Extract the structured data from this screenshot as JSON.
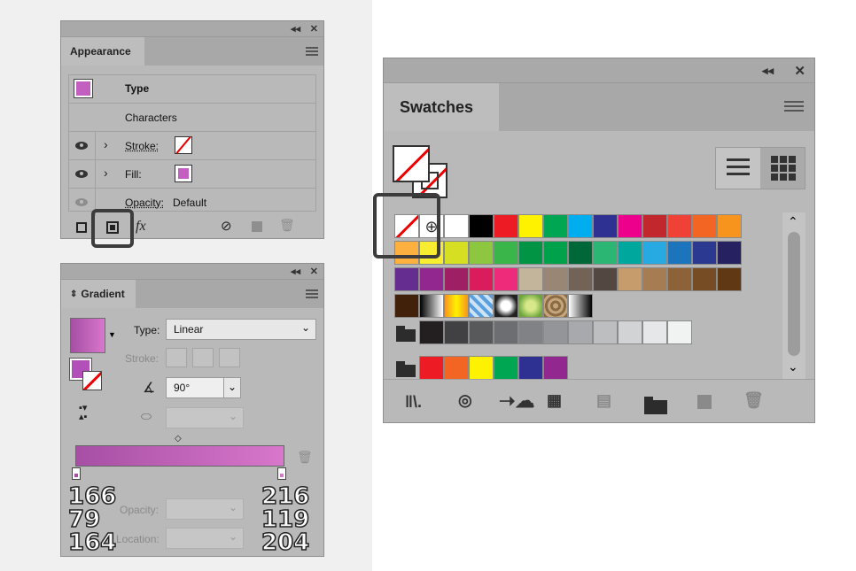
{
  "appearance": {
    "tab": "Appearance",
    "rows": {
      "type_label": "Type",
      "characters_label": "Characters",
      "stroke_label": "Stroke:",
      "fill_label": "Fill:",
      "opacity_label": "Opacity:",
      "opacity_value": "Default"
    },
    "footer": {
      "fx_label": "fx"
    }
  },
  "gradient": {
    "tab": "Gradient",
    "type_label": "Type:",
    "type_value": "Linear",
    "stroke_label": "Stroke:",
    "angle_value": "90°",
    "opacity_label": "Opacity:",
    "location_label": "Location:",
    "left_stop_rgb": [
      "166",
      "79",
      "164"
    ],
    "right_stop_rgb": [
      "216",
      "119",
      "204"
    ],
    "colors": {
      "start": "#a64fa4",
      "end": "#d877cc"
    }
  },
  "swatches": {
    "tab": "Swatches",
    "row1": [
      "#ffffff",
      "#000000",
      "#ed1c24",
      "#fff200",
      "#00a651",
      "#00aeef",
      "#2e3192",
      "#ec008c",
      "#c1272d",
      "#ef4136",
      "#f26522",
      "#f7941d"
    ],
    "row2": [
      "#fbb040",
      "#f9ed32",
      "#d7df23",
      "#8dc63f",
      "#39b54a",
      "#009444",
      "#00a14b",
      "#006838",
      "#2bb673",
      "#00a79d",
      "#27aae1",
      "#1c75bc",
      "#2b3990",
      "#262262"
    ],
    "row3": [
      "#662d91",
      "#92278f",
      "#9e1f63",
      "#da1c5c",
      "#ee2a7b",
      "#c2b59b",
      "#998675",
      "#736357",
      "#534741",
      "#c69c6d",
      "#a67c52",
      "#8c6239",
      "#754c24",
      "#603813"
    ],
    "row4": [
      "#42210b"
    ],
    "grays": [
      "#231f20",
      "#414042",
      "#58595b",
      "#6d6e71",
      "#808285",
      "#939598",
      "#a7a9ac",
      "#bcbec0",
      "#d1d3d4",
      "#e6e7e8",
      "#f1f2f2"
    ],
    "brights": [
      "#ed1c24",
      "#f26522",
      "#fff200",
      "#00a651",
      "#2e3192",
      "#92278f"
    ]
  }
}
